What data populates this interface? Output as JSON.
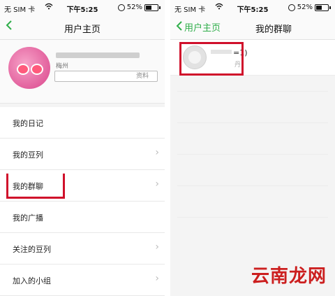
{
  "status_left": {
    "carrier": "无 SIM 卡",
    "time": "下午5:25",
    "battery": "52%",
    "battery_level": 0.52
  },
  "status_right": {
    "carrier": "无 SIM 卡",
    "time": "下午5:25",
    "battery": "52%",
    "battery_level": 0.52
  },
  "left_screen": {
    "nav": {
      "back_icon": "chevron-left-icon",
      "title": "用户主页"
    },
    "profile": {
      "location": "梅州",
      "edit_button": "资料"
    },
    "menu": [
      {
        "label": "我的日记",
        "has_chevron": false
      },
      {
        "label": "我的豆列",
        "has_chevron": true
      },
      {
        "label": "我的群聊",
        "has_chevron": true
      },
      {
        "label": "我的广播",
        "has_chevron": false
      },
      {
        "label": "关注的豆列",
        "has_chevron": true
      },
      {
        "label": "加入的小组",
        "has_chevron": true
      }
    ]
  },
  "right_screen": {
    "nav": {
      "back_label": "用户主页",
      "title": "我的群聊"
    },
    "group": {
      "name_suffix": "=1)",
      "sub": "丹"
    }
  },
  "watermark": "云南龙网",
  "colors": {
    "accent_green": "#2fae4a",
    "highlight_red": "#d0102b",
    "watermark_red": "#cc1f1f"
  }
}
